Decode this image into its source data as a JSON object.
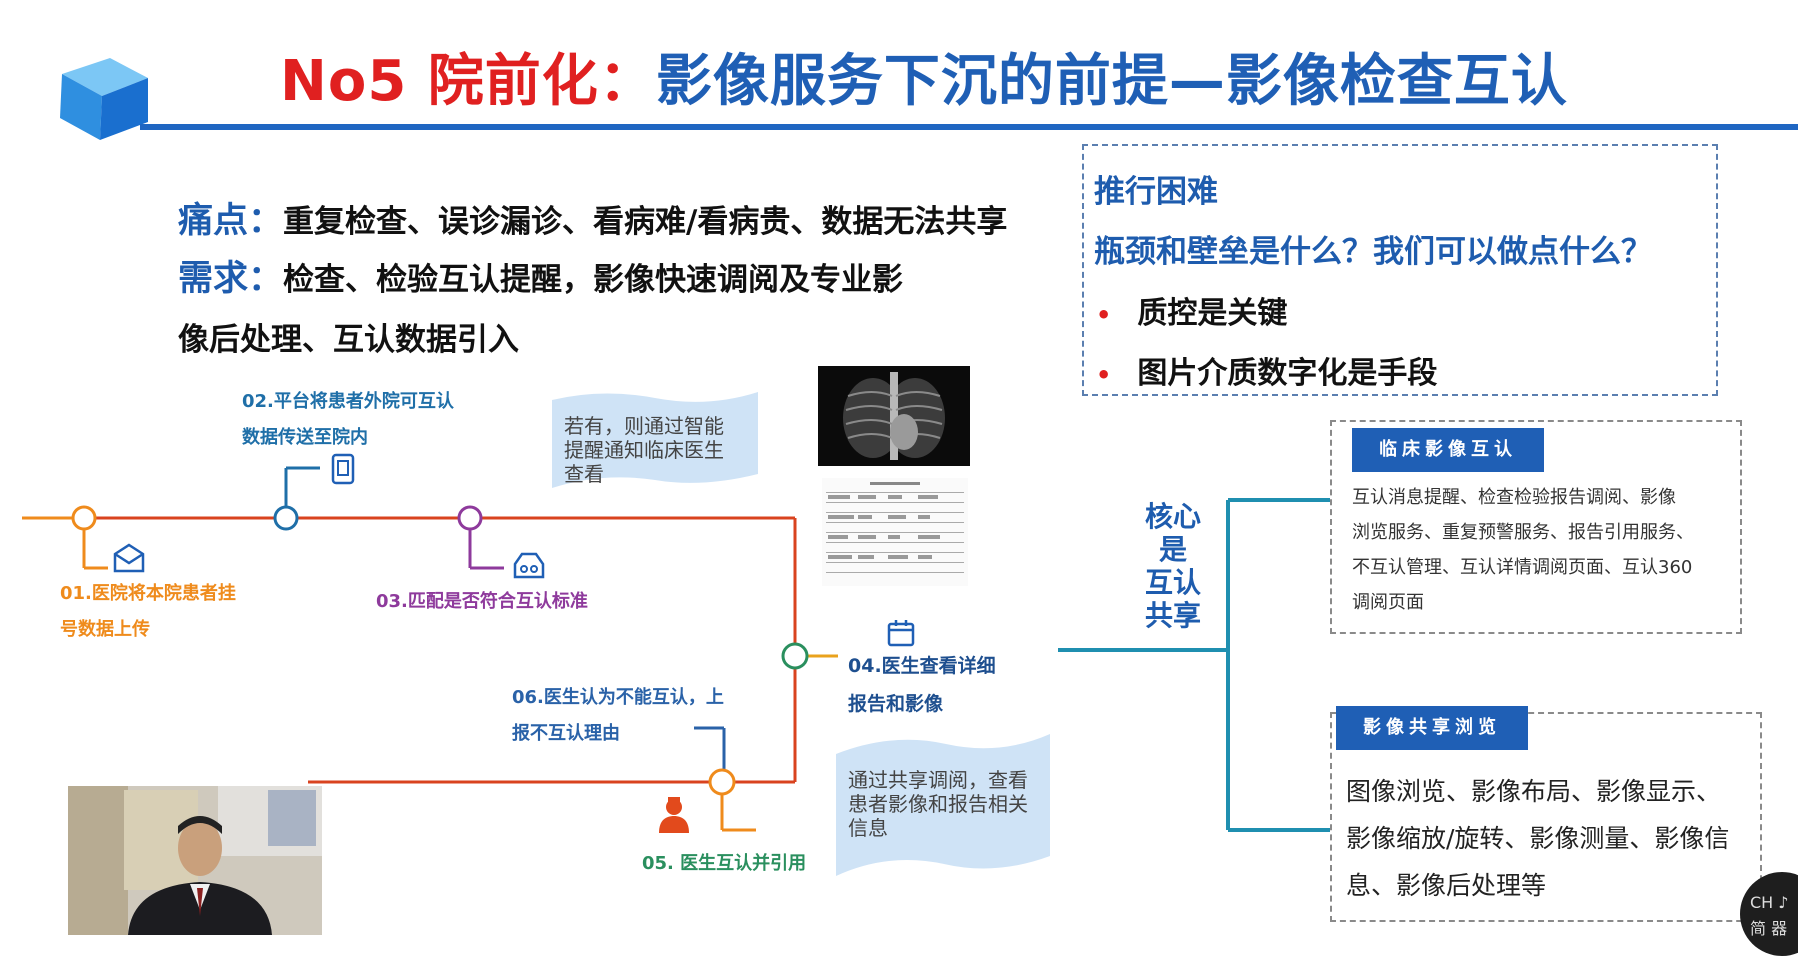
{
  "slide": {
    "title_red": "No5 院前化：",
    "title_blue": "影像服务下沉的前提—影像检查互认",
    "pain_key": "痛点：",
    "pain_text": "重复检查、误诊漏诊、看病难/看病贵、数据无法共享",
    "need_key": "需求：",
    "need_text_line1": "检查、检验互认提醒，影像快速调阅及专业影",
    "need_text_line2": "像后处理、互认数据引入"
  },
  "difficulty_box": {
    "heading": "推行困难",
    "question": "瓶颈和壁垒是什么？我们可以做点什么？",
    "bullets": [
      "质控是关键",
      "图片介质数字化是手段"
    ]
  },
  "flow": {
    "step01": [
      "01.医院将本院患者挂",
      "号数据上传"
    ],
    "step02": [
      "02.平台将患者外院可互认",
      "数据传送至院内"
    ],
    "step03": "03.匹配是否符合互认标准",
    "step04": [
      "04.医生查看详细",
      "报告和影像"
    ],
    "step05": "05. 医生互认并引用",
    "step06": [
      "06.医生认为不能互认，上",
      "报不互认理由"
    ],
    "note_top": [
      "若有，则通过智能",
      "提醒通知临床医生",
      "查看"
    ],
    "note_bottom": [
      "通过共享调阅，查看",
      "患者影像和报告相关",
      "信息"
    ],
    "colors": {
      "orange": "#ef8b1c",
      "red_line": "#d9431f",
      "purple": "#8e3a9c",
      "teal": "#1f8fb0",
      "green": "#2a8f5e",
      "blue": "#2a62a8"
    }
  },
  "core": [
    "核心",
    "是",
    "互认",
    "共享"
  ],
  "panel_clinical": {
    "heading": "临床影像互认",
    "lines": [
      "互认消息提醒、检查检验报告调阅、影像",
      "浏览服务、重复预警服务、报告引用服务、",
      "不互认管理、互认详情调阅页面、互认360",
      "调阅页面"
    ]
  },
  "panel_share": {
    "heading": "影像共享浏览",
    "lines": [
      "图像浏览、影像布局、影像显示、",
      "影像缩放/旋转、影像测量、影像信",
      "息、影像后处理等"
    ]
  },
  "ime_badge": {
    "line1": "CH ♪",
    "line2": "简 器"
  },
  "icons": [
    "cube-logo-icon",
    "envelope-icon",
    "tablet-icon",
    "inbox-icon",
    "calendar-icon",
    "doctor-icon",
    "xray-image-icon",
    "report-document-icon"
  ]
}
